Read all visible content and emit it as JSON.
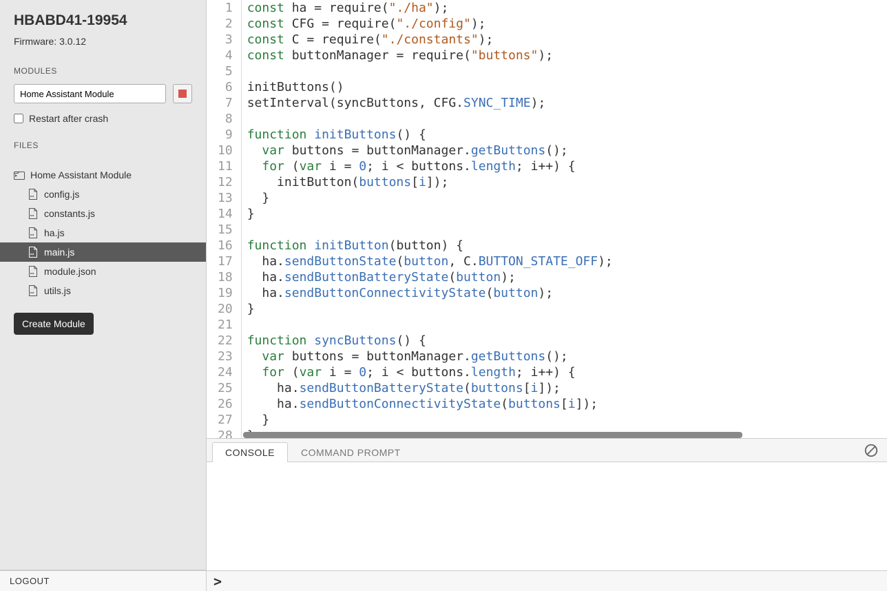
{
  "device": {
    "name": "HBABD41-19954",
    "firmware_label": "Firmware: 3.0.12"
  },
  "modules": {
    "title": "MODULES",
    "input_value": "Home Assistant Module",
    "restart_label": "Restart after crash",
    "restart_checked": false
  },
  "files": {
    "title": "FILES",
    "folder": "Home Assistant Module",
    "items": [
      {
        "name": "config.js",
        "selected": false
      },
      {
        "name": "constants.js",
        "selected": false
      },
      {
        "name": "ha.js",
        "selected": false
      },
      {
        "name": "main.js",
        "selected": true
      },
      {
        "name": "module.json",
        "selected": false
      },
      {
        "name": "utils.js",
        "selected": false
      }
    ],
    "create_label": "Create Module"
  },
  "code": {
    "lines": [
      [
        [
          "kw",
          "const"
        ],
        [
          "",
          " ha "
        ],
        [
          "pun",
          "="
        ],
        [
          "",
          " require"
        ],
        [
          "pun",
          "("
        ],
        [
          "str",
          "\"./ha\""
        ],
        [
          "pun",
          ");"
        ]
      ],
      [
        [
          "kw",
          "const"
        ],
        [
          "",
          " CFG "
        ],
        [
          "pun",
          "="
        ],
        [
          "",
          " require"
        ],
        [
          "pun",
          "("
        ],
        [
          "str",
          "\"./config\""
        ],
        [
          "pun",
          ");"
        ]
      ],
      [
        [
          "kw",
          "const"
        ],
        [
          "",
          " C "
        ],
        [
          "pun",
          "="
        ],
        [
          "",
          " require"
        ],
        [
          "pun",
          "("
        ],
        [
          "str",
          "\"./constants\""
        ],
        [
          "pun",
          ");"
        ]
      ],
      [
        [
          "kw",
          "const"
        ],
        [
          "",
          " buttonManager "
        ],
        [
          "pun",
          "="
        ],
        [
          "",
          " require"
        ],
        [
          "pun",
          "("
        ],
        [
          "str",
          "\"buttons\""
        ],
        [
          "pun",
          ");"
        ]
      ],
      [
        [
          "",
          ""
        ]
      ],
      [
        [
          "",
          "initButtons"
        ],
        [
          "pun",
          "()"
        ]
      ],
      [
        [
          "",
          "setInterval"
        ],
        [
          "pun",
          "("
        ],
        [
          "",
          "syncButtons"
        ],
        [
          "pun",
          ","
        ],
        [
          "",
          " CFG"
        ],
        [
          "pun",
          "."
        ],
        [
          "prop",
          "SYNC_TIME"
        ],
        [
          "pun",
          ");"
        ]
      ],
      [
        [
          "",
          ""
        ]
      ],
      [
        [
          "kw",
          "function"
        ],
        [
          "",
          " "
        ],
        [
          "fn",
          "initButtons"
        ],
        [
          "pun",
          "() {"
        ]
      ],
      [
        [
          "",
          "  "
        ],
        [
          "kw",
          "var"
        ],
        [
          "",
          " buttons "
        ],
        [
          "pun",
          "="
        ],
        [
          "",
          " buttonManager"
        ],
        [
          "pun",
          "."
        ],
        [
          "prop",
          "getButtons"
        ],
        [
          "pun",
          "();"
        ]
      ],
      [
        [
          "",
          "  "
        ],
        [
          "kw",
          "for"
        ],
        [
          "",
          " "
        ],
        [
          "pun",
          "("
        ],
        [
          "kw",
          "var"
        ],
        [
          "",
          " i "
        ],
        [
          "pun",
          "="
        ],
        [
          "",
          " "
        ],
        [
          "num",
          "0"
        ],
        [
          "pun",
          ";"
        ],
        [
          "",
          " i "
        ],
        [
          "pun",
          "<"
        ],
        [
          "",
          " buttons"
        ],
        [
          "pun",
          "."
        ],
        [
          "prop",
          "length"
        ],
        [
          "pun",
          ";"
        ],
        [
          "",
          " i"
        ],
        [
          "pun",
          "++) {"
        ]
      ],
      [
        [
          "",
          "    initButton"
        ],
        [
          "pun",
          "("
        ],
        [
          "prop",
          "buttons"
        ],
        [
          "pun",
          "["
        ],
        [
          "prop",
          "i"
        ],
        [
          "pun",
          "]);"
        ]
      ],
      [
        [
          "",
          "  "
        ],
        [
          "pun",
          "}"
        ]
      ],
      [
        [
          "pun",
          "}"
        ]
      ],
      [
        [
          "",
          ""
        ]
      ],
      [
        [
          "kw",
          "function"
        ],
        [
          "",
          " "
        ],
        [
          "fn",
          "initButton"
        ],
        [
          "pun",
          "("
        ],
        [
          "",
          "button"
        ],
        [
          "pun",
          ") {"
        ]
      ],
      [
        [
          "",
          "  ha"
        ],
        [
          "pun",
          "."
        ],
        [
          "prop",
          "sendButtonState"
        ],
        [
          "pun",
          "("
        ],
        [
          "prop",
          "button"
        ],
        [
          "pun",
          ","
        ],
        [
          "",
          " C"
        ],
        [
          "pun",
          "."
        ],
        [
          "prop",
          "BUTTON_STATE_OFF"
        ],
        [
          "pun",
          ");"
        ]
      ],
      [
        [
          "",
          "  ha"
        ],
        [
          "pun",
          "."
        ],
        [
          "prop",
          "sendButtonBatteryState"
        ],
        [
          "pun",
          "("
        ],
        [
          "prop",
          "button"
        ],
        [
          "pun",
          ");"
        ]
      ],
      [
        [
          "",
          "  ha"
        ],
        [
          "pun",
          "."
        ],
        [
          "prop",
          "sendButtonConnectivityState"
        ],
        [
          "pun",
          "("
        ],
        [
          "prop",
          "button"
        ],
        [
          "pun",
          ");"
        ]
      ],
      [
        [
          "pun",
          "}"
        ]
      ],
      [
        [
          "",
          ""
        ]
      ],
      [
        [
          "kw",
          "function"
        ],
        [
          "",
          " "
        ],
        [
          "fn",
          "syncButtons"
        ],
        [
          "pun",
          "() {"
        ]
      ],
      [
        [
          "",
          "  "
        ],
        [
          "kw",
          "var"
        ],
        [
          "",
          " buttons "
        ],
        [
          "pun",
          "="
        ],
        [
          "",
          " buttonManager"
        ],
        [
          "pun",
          "."
        ],
        [
          "prop",
          "getButtons"
        ],
        [
          "pun",
          "();"
        ]
      ],
      [
        [
          "",
          "  "
        ],
        [
          "kw",
          "for"
        ],
        [
          "",
          " "
        ],
        [
          "pun",
          "("
        ],
        [
          "kw",
          "var"
        ],
        [
          "",
          " i "
        ],
        [
          "pun",
          "="
        ],
        [
          "",
          " "
        ],
        [
          "num",
          "0"
        ],
        [
          "pun",
          ";"
        ],
        [
          "",
          " i "
        ],
        [
          "pun",
          "<"
        ],
        [
          "",
          " buttons"
        ],
        [
          "pun",
          "."
        ],
        [
          "prop",
          "length"
        ],
        [
          "pun",
          ";"
        ],
        [
          "",
          " i"
        ],
        [
          "pun",
          "++) {"
        ]
      ],
      [
        [
          "",
          "    ha"
        ],
        [
          "pun",
          "."
        ],
        [
          "prop",
          "sendButtonBatteryState"
        ],
        [
          "pun",
          "("
        ],
        [
          "prop",
          "buttons"
        ],
        [
          "pun",
          "["
        ],
        [
          "prop",
          "i"
        ],
        [
          "pun",
          "]);"
        ]
      ],
      [
        [
          "",
          "    ha"
        ],
        [
          "pun",
          "."
        ],
        [
          "prop",
          "sendButtonConnectivityState"
        ],
        [
          "pun",
          "("
        ],
        [
          "prop",
          "buttons"
        ],
        [
          "pun",
          "["
        ],
        [
          "prop",
          "i"
        ],
        [
          "pun",
          "]);"
        ]
      ],
      [
        [
          "",
          "  "
        ],
        [
          "pun",
          "}"
        ]
      ],
      [
        [
          "pun",
          "}"
        ]
      ],
      [
        [
          "",
          ""
        ]
      ]
    ]
  },
  "console": {
    "tabs": [
      "CONSOLE",
      "COMMAND PROMPT"
    ],
    "active_tab": 0,
    "prompt": ">"
  },
  "footer": {
    "logout": "LOGOUT"
  }
}
